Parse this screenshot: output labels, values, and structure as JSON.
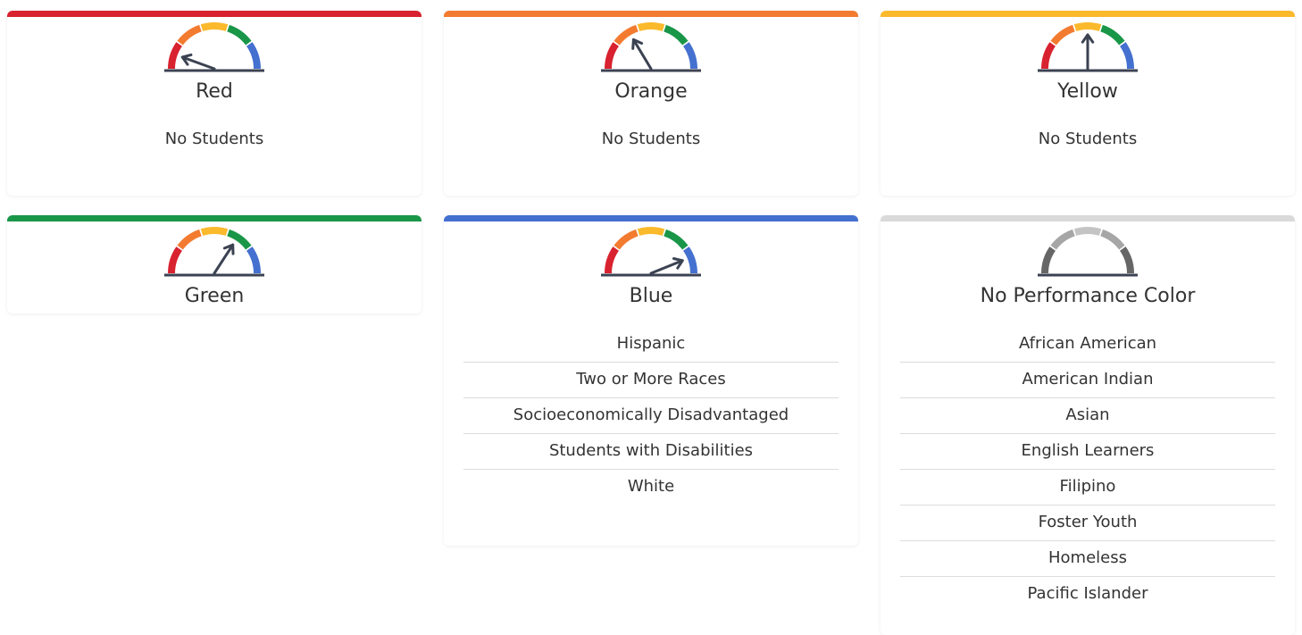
{
  "cards": [
    {
      "title": "Red",
      "bar_color": "#d8222f",
      "needle_deg": 160,
      "gray": false,
      "empty_text": "No Students",
      "items": []
    },
    {
      "title": "Orange",
      "bar_color": "#f37b30",
      "needle_deg": 121,
      "gray": false,
      "empty_text": "No Students",
      "items": []
    },
    {
      "title": "Yellow",
      "bar_color": "#fbb92c",
      "needle_deg": 90,
      "gray": false,
      "empty_text": "No Students",
      "items": []
    },
    {
      "title": "Green",
      "bar_color": "#1a9648",
      "needle_deg": 57,
      "gray": false,
      "empty_text": "No Students",
      "items": []
    },
    {
      "title": "Blue",
      "bar_color": "#4470d0",
      "needle_deg": 22,
      "gray": false,
      "empty_text": "",
      "items": [
        "Hispanic",
        "Two or More Races",
        "Socioeconomically Disadvantaged",
        "Students with Disabilities",
        "White"
      ]
    },
    {
      "title": "No Performance Color",
      "bar_color": "#d9d9d9",
      "needle_deg": null,
      "gray": true,
      "empty_text": "",
      "items": [
        "African American",
        "American Indian",
        "Asian",
        "English Learners",
        "Filipino",
        "Foster Youth",
        "Homeless",
        "Pacific Islander"
      ]
    }
  ],
  "gauge_colors": {
    "segments": [
      "#d8222f",
      "#f37b30",
      "#fbb92c",
      "#1a9648",
      "#4470d0"
    ],
    "gray_segments": [
      "#666666",
      "#a6a6a6",
      "#c4c4c4",
      "#a6a6a6",
      "#666666"
    ],
    "needle": "#3b4252",
    "base": "#3b4252"
  }
}
